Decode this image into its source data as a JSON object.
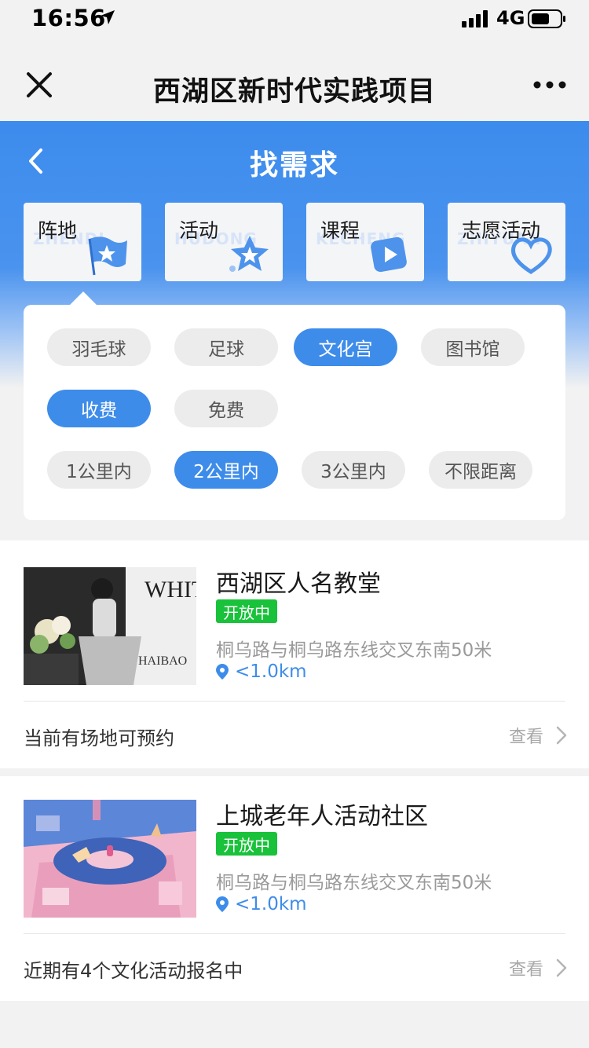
{
  "status_bar": {
    "time": "16:56",
    "network": "4G"
  },
  "nav": {
    "title": "西湖区新时代实践项目"
  },
  "header": {
    "title": "找需求",
    "accent_color": "#3c8ced"
  },
  "categories": [
    {
      "label": "阵地",
      "ghost": "ZHENDI",
      "icon": "flag-icon"
    },
    {
      "label": "活动",
      "ghost": "HUDONG",
      "icon": "star-icon"
    },
    {
      "label": "课程",
      "ghost": "KECHENG",
      "icon": "play-icon"
    },
    {
      "label": "志愿活动",
      "ghost": "ZHIYUAN",
      "icon": "heart-icon"
    }
  ],
  "filters": {
    "venue_types": [
      {
        "label": "羽毛球",
        "active": false
      },
      {
        "label": "足球",
        "active": false
      },
      {
        "label": "文化宫",
        "active": true
      },
      {
        "label": "图书馆",
        "active": false
      }
    ],
    "fee": [
      {
        "label": "收费",
        "active": true
      },
      {
        "label": "免费",
        "active": false
      }
    ],
    "distance": [
      {
        "label": "1公里内",
        "active": false
      },
      {
        "label": "2公里内",
        "active": true
      },
      {
        "label": "3公里内",
        "active": false
      },
      {
        "label": "不限距离",
        "active": false
      }
    ]
  },
  "results": [
    {
      "title": "西湖区人名教堂",
      "status": "开放中",
      "address": "桐乌路与桐乌路东线交叉东南50米",
      "distance": "<1.0km",
      "footer": "当前有场地可预约",
      "action": "查看"
    },
    {
      "title": "上城老年人活动社区",
      "status": "开放中",
      "address": "桐乌路与桐乌路东线交叉东南50米",
      "distance": "<1.0km",
      "footer": "近期有4个文化活动报名中",
      "action": "查看"
    }
  ]
}
